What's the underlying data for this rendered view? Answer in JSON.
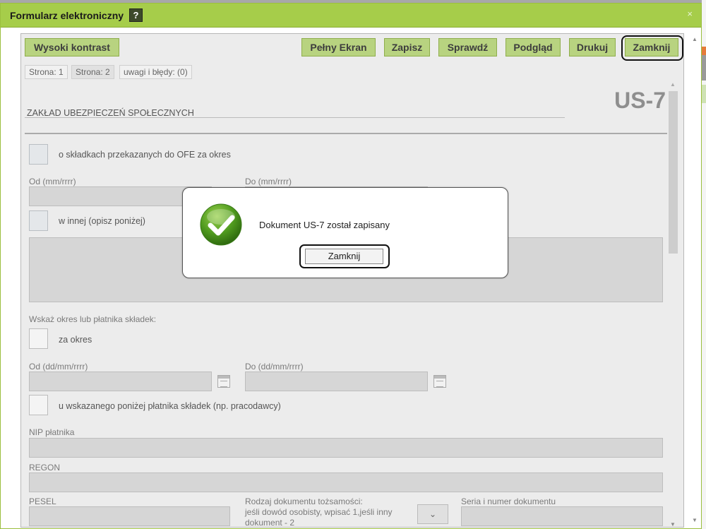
{
  "window": {
    "title": "Formularz elektroniczny",
    "help": "?",
    "close": "×"
  },
  "toolbar": {
    "high_contrast": "Wysoki kontrast",
    "fullscreen": "Pełny Ekran",
    "save": "Zapisz",
    "check": "Sprawdź",
    "preview": "Podgląd",
    "print": "Drukuj",
    "close": "Zamknij"
  },
  "tabs": [
    "Strona: 1",
    "Strona: 2",
    "uwagi i błędy: (0)"
  ],
  "form": {
    "organization": "ZAKŁAD UBEZPIECZEŃ SPOŁECZNYCH",
    "code": "US-7",
    "ofe_option": "o składkach przekazanych do OFE za okres",
    "from_mm": "Od (mm/rrrr)",
    "to_mm": "Do (mm/rrrr)",
    "other_option": "w innej (opisz poniżej)",
    "period_prompt": "Wskaż okres lub płatnika składek:",
    "period_option": "za okres",
    "from_dd": "Od (dd/mm/rrrr)",
    "to_dd": "Do (dd/mm/rrrr)",
    "payer_option": "u wskazanego poniżej płatnika składek (np. pracodawcy)",
    "nip": "NIP płatnika",
    "regon": "REGON",
    "pesel": "PESEL",
    "doc_type_line1": "Rodzaj dokumentu tożsamości:",
    "doc_type_line2": "jeśli dowód osobisty, wpisać 1,jeśli inny",
    "doc_type_line3": "dokument - 2",
    "doc_series": "Seria i numer dokumentu",
    "select_arrow": "⌄"
  },
  "dialog": {
    "message": "Dokument US-7 został zapisany",
    "button": "Zamknij"
  },
  "colors": {
    "accent": "#a6cd4a",
    "button": "#b8d380",
    "field": "#d6d6d6"
  },
  "icons": {
    "help": "help-icon",
    "close": "close-icon",
    "success": "checkmark-success-icon",
    "calendar": "calendar-icon"
  }
}
